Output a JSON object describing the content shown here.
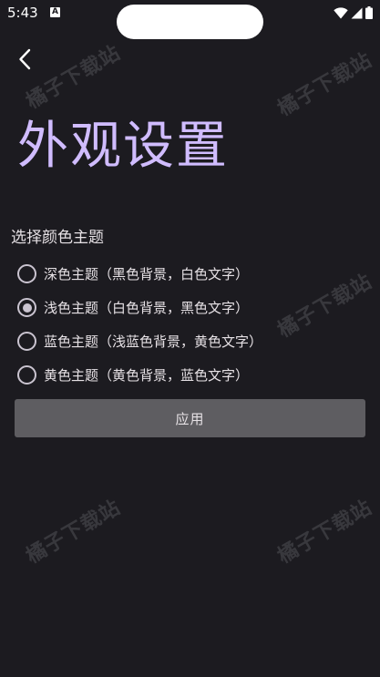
{
  "status_bar": {
    "time": "5:43",
    "notification_icon": "A"
  },
  "header": {
    "back_icon": "chevron-left-icon",
    "title": "外观设置"
  },
  "theme_section": {
    "label": "选择颜色主题",
    "options": [
      {
        "label": "深色主题（黑色背景，白色文字）",
        "selected": false
      },
      {
        "label": "浅色主题（白色背景，黑色文字）",
        "selected": true
      },
      {
        "label": "蓝色主题（浅蓝色背景，黄色文字）",
        "selected": false
      },
      {
        "label": "黄色主题（黄色背景，蓝色文字）",
        "selected": false
      }
    ]
  },
  "apply_button": {
    "label": "应用"
  },
  "watermark": {
    "text": "橘子下载站"
  },
  "colors": {
    "background": "#1c1b20",
    "title": "#d0bcff",
    "text": "#e6e1e5",
    "radio": "#cac4d0",
    "button": "#5e5d61"
  }
}
